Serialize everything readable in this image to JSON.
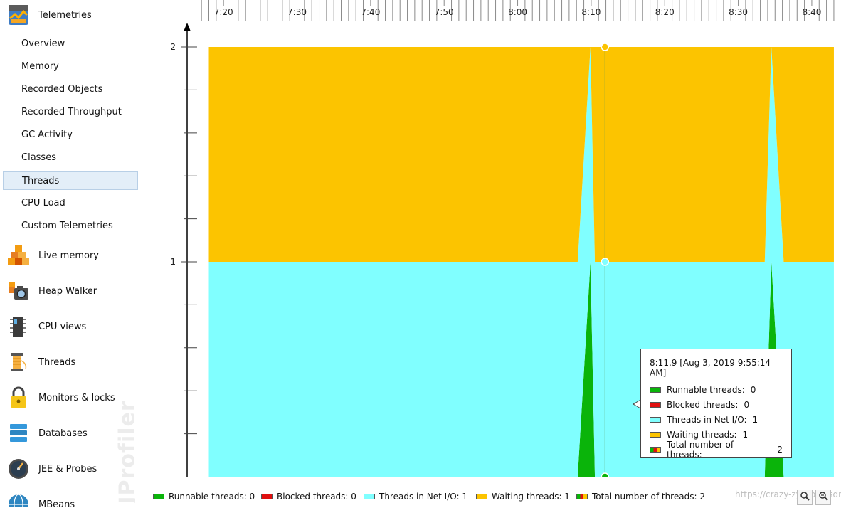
{
  "sidebar": {
    "telemetries": {
      "label": "Telemetries",
      "items": [
        {
          "label": "Overview"
        },
        {
          "label": "Memory"
        },
        {
          "label": "Recorded Objects"
        },
        {
          "label": "Recorded Throughput"
        },
        {
          "label": "GC Activity"
        },
        {
          "label": "Classes"
        },
        {
          "label": "Threads",
          "selected": true
        },
        {
          "label": "CPU Load"
        },
        {
          "label": "Custom Telemetries"
        }
      ]
    },
    "sections": [
      {
        "label": "Live memory",
        "icon": "live-memory-icon"
      },
      {
        "label": "Heap Walker",
        "icon": "heap-walker-icon"
      },
      {
        "label": "CPU views",
        "icon": "cpu-views-icon"
      },
      {
        "label": "Threads",
        "icon": "threads-spool-icon"
      },
      {
        "label": "Monitors & locks",
        "icon": "lock-icon"
      },
      {
        "label": "Databases",
        "icon": "database-icon"
      },
      {
        "label": "JEE & Probes",
        "icon": "gauge-icon"
      },
      {
        "label": "MBeans",
        "icon": "globe-icon"
      }
    ],
    "watermark": "JProfiler"
  },
  "time_axis": {
    "labels": [
      "7:20",
      "7:30",
      "7:40",
      "7:50",
      "8:00",
      "8:10",
      "8:20",
      "8:30",
      "8:40"
    ]
  },
  "chart_data": {
    "type": "area",
    "stacked": true,
    "x_unit": "minutes",
    "x": [
      7.3,
      8.108,
      8.136,
      8.165,
      8.175,
      8.192,
      8.523,
      8.56,
      8.575,
      8.603,
      8.7167
    ],
    "series": [
      {
        "name": "Runnable threads",
        "color": "#0ab40a",
        "values": [
          0,
          0,
          0,
          1,
          0,
          0,
          0,
          0,
          1,
          0,
          0
        ]
      },
      {
        "name": "Blocked threads",
        "color": "#e01010",
        "values": [
          0,
          0,
          0,
          0,
          0,
          0,
          0,
          0,
          0,
          0,
          0
        ]
      },
      {
        "name": "Threads in Net I/O",
        "color": "#80ffff",
        "values": [
          1,
          1,
          1,
          1,
          1,
          1,
          1,
          1,
          1,
          1,
          1
        ]
      },
      {
        "name": "Waiting threads",
        "color": "#fcc400",
        "values": [
          1,
          1,
          1,
          0,
          1,
          1,
          1,
          1,
          0,
          1,
          1
        ]
      }
    ],
    "y_ticks": [
      1,
      2
    ],
    "ylim": [
      0,
      2.02
    ],
    "xlim": [
      7.275,
      8.72
    ],
    "cursor_x": 8.198,
    "grid": false
  },
  "tooltip": {
    "title": "8:11.9 [Aug 3, 2019 9:55:14 AM]",
    "rows": [
      {
        "label": "Runnable threads:",
        "value": "0",
        "color": "#0ab40a"
      },
      {
        "label": "Blocked threads:",
        "value": "0",
        "color": "#e01010"
      },
      {
        "label": "Threads in Net I/O:",
        "value": "1",
        "color": "#80ffff"
      },
      {
        "label": "Waiting threads:",
        "value": "1",
        "color": "#fcc400"
      },
      {
        "label": "Total number of threads:",
        "value": "2",
        "color": "multi"
      }
    ]
  },
  "legend": {
    "items": [
      {
        "label": "Runnable threads: 0",
        "color": "#0ab40a"
      },
      {
        "label": "Blocked threads: 0",
        "color": "#e01010"
      },
      {
        "label": "Threads in Net I/O: 1",
        "color": "#80ffff"
      },
      {
        "label": "Waiting threads: 1",
        "color": "#fcc400"
      },
      {
        "label": "Total number of threads: 2",
        "color": "multi"
      }
    ]
  },
  "watermark_url": "https://crazy-zy.blog.csdn.net"
}
